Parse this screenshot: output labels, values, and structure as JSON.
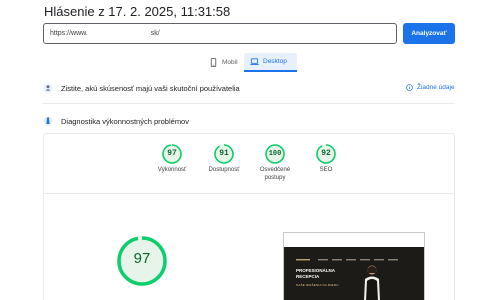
{
  "report": {
    "title": "Hlásenie z 17. 2. 2025, 11:31:58"
  },
  "search": {
    "url_prefix": "https://www.",
    "url_suffix": "sk/",
    "analyze_label": "Analyzovať"
  },
  "tabs": [
    {
      "label": "Mobil",
      "icon": "phone-icon",
      "selected": false
    },
    {
      "label": "Desktop",
      "icon": "laptop-icon",
      "selected": true
    }
  ],
  "crux": {
    "label": "Zistite, akú skúsenosť majú vaši skutoční používatelia",
    "no_data_label": "Žiadne údaje",
    "icon": "users-icon"
  },
  "diagnostics": {
    "label": "Diagnostika výkonnostných problémov",
    "icon": "lighthouse-icon"
  },
  "scores": [
    {
      "value": "97",
      "label": "Výkonnosť",
      "label2": ""
    },
    {
      "value": "91",
      "label": "Dostupnosť",
      "label2": ""
    },
    {
      "value": "100",
      "label": "Osvedčené",
      "label2": "postupy"
    },
    {
      "value": "92",
      "label": "SEO",
      "label2": ""
    }
  ],
  "main_score": {
    "value": "97"
  },
  "preview": {
    "heading_line1": "PROFESIONÁLNA",
    "heading_line2": "RECEPCIA",
    "subtitle": "NAŠE RIEŠENIA NA MIERU"
  },
  "colors": {
    "accent": "#1a73e8",
    "pass_green": "#0cce6b",
    "pass_text": "#0d652d",
    "pass_bg": "#e6f4ea"
  }
}
